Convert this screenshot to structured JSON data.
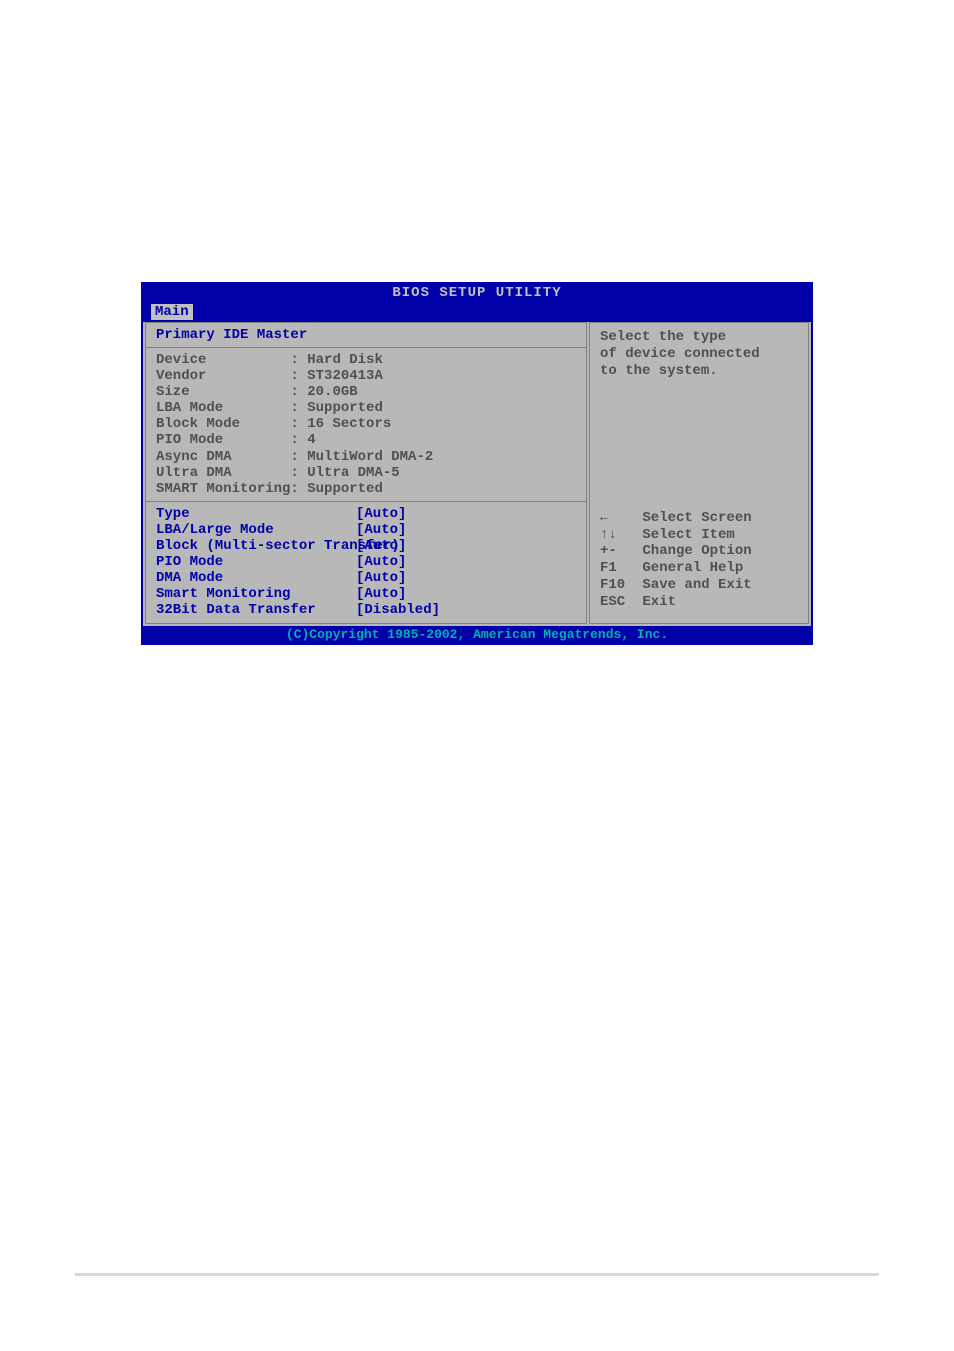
{
  "title": "BIOS SETUP UTILITY",
  "tab": "Main",
  "section_title": "Primary IDE Master",
  "info": [
    {
      "label": "Device",
      "value": "Hard Disk"
    },
    {
      "label": "Vendor",
      "value": "ST320413A"
    },
    {
      "label": "Size",
      "value": "20.0GB"
    },
    {
      "label": "LBA Mode",
      "value": "Supported"
    },
    {
      "label": "Block Mode",
      "value": "16 Sectors"
    },
    {
      "label": "PIO Mode",
      "value": "4"
    },
    {
      "label": "Async DMA",
      "value": "MultiWord DMA-2"
    },
    {
      "label": "Ultra DMA",
      "value": "Ultra DMA-5"
    },
    {
      "label": "SMART Monitoring",
      "value": "Supported"
    }
  ],
  "options": [
    {
      "label": "Type",
      "value": "[Auto]"
    },
    {
      "label": "LBA/Large Mode",
      "value": "[Auto]"
    },
    {
      "label": "Block (Multi-sector Transfer)",
      "value": "[Auto]"
    },
    {
      "label": "PIO Mode",
      "value": "[Auto]"
    },
    {
      "label": "DMA Mode",
      "value": "[Auto]"
    },
    {
      "label": "Smart Monitoring",
      "value": "[Auto]"
    },
    {
      "label": "32Bit Data Transfer",
      "value": "[Disabled]"
    }
  ],
  "help": {
    "line1": "Select the type",
    "line2": "of device connected",
    "line3": "to the system."
  },
  "nav": [
    {
      "key": "←",
      "desc": "Select Screen"
    },
    {
      "key": "↑↓",
      "desc": "Select Item"
    },
    {
      "key": "+-",
      "desc": "Change Option"
    },
    {
      "key": "F1",
      "desc": "General Help"
    },
    {
      "key": "F10",
      "desc": "Save and Exit"
    },
    {
      "key": "ESC",
      "desc": "Exit"
    }
  ],
  "footer": "(C)Copyright 1985-2002, American Megatrends, Inc."
}
